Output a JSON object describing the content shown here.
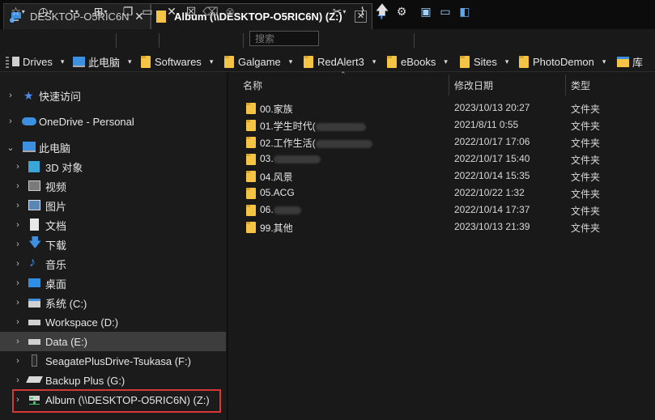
{
  "tabs": [
    {
      "title": "DESKTOP-O5RIC6N",
      "active": false
    },
    {
      "title": "Album (\\\\DESKTOP-O5RIC6N) (Z:)",
      "active": true
    }
  ],
  "tab_close_glyph": "✕",
  "tab_add_glyph": "+",
  "toolbar": {
    "search_placeholder": "搜索"
  },
  "bookmarks": [
    {
      "label": "Drives",
      "icon": "drive-icon"
    },
    {
      "label": "此电脑",
      "icon": "computer-icon"
    },
    {
      "label": "Softwares",
      "icon": "folder-icon"
    },
    {
      "label": "Galgame",
      "icon": "folder-icon"
    },
    {
      "label": "RedAlert3",
      "icon": "folder-icon"
    },
    {
      "label": "eBooks",
      "icon": "folder-icon"
    },
    {
      "label": "Sites",
      "icon": "folder-icon"
    },
    {
      "label": "PhotoDemon",
      "icon": "folder-icon"
    },
    {
      "label": "库",
      "icon": "library-icon"
    }
  ],
  "nav": [
    {
      "label": "快速访问",
      "icon": "star-icon",
      "expanded": false
    },
    {
      "label": "OneDrive - Personal",
      "icon": "cloud-icon",
      "expanded": false
    },
    {
      "label": "此电脑",
      "icon": "computer-icon",
      "expanded": true
    },
    {
      "label": "3D 对象",
      "icon": "cube-icon"
    },
    {
      "label": "视频",
      "icon": "video-icon"
    },
    {
      "label": "图片",
      "icon": "picture-icon"
    },
    {
      "label": "文档",
      "icon": "document-icon"
    },
    {
      "label": "下载",
      "icon": "download-icon"
    },
    {
      "label": "音乐",
      "icon": "music-icon"
    },
    {
      "label": "桌面",
      "icon": "desktop-icon"
    },
    {
      "label": "系统 (C:)",
      "icon": "system-drive-icon"
    },
    {
      "label": "Workspace (D:)",
      "icon": "drive-icon"
    },
    {
      "label": "Data (E:)",
      "icon": "drive-icon",
      "selected": true
    },
    {
      "label": "SeagatePlusDrive-Tsukasa (F:)",
      "icon": "external-drive-icon"
    },
    {
      "label": "Backup Plus (G:)",
      "icon": "external-drive-icon"
    },
    {
      "label": "Album (\\\\DESKTOP-O5RIC6N) (Z:)",
      "icon": "network-drive-icon",
      "highlighted": true
    }
  ],
  "columns": {
    "name": "名称",
    "modified": "修改日期",
    "type": "类型"
  },
  "files": [
    {
      "name": "00.家族",
      "date": "2023/10/13 20:27",
      "type": "文件夹"
    },
    {
      "name": "01.学生时代(",
      "date": "2021/8/11 0:55",
      "type": "文件夹",
      "redacted": true
    },
    {
      "name": "02.工作生活(",
      "date": "2022/10/17 17:06",
      "type": "文件夹",
      "redacted": true
    },
    {
      "name": "03.",
      "date": "2022/10/17 15:40",
      "type": "文件夹",
      "redacted": true
    },
    {
      "name": "04.风景",
      "date": "2022/10/14 15:35",
      "type": "文件夹"
    },
    {
      "name": "05.ACG",
      "date": "2022/10/22 1:32",
      "type": "文件夹"
    },
    {
      "name": "06.",
      "date": "2022/10/14 17:37",
      "type": "文件夹",
      "redacted": true
    },
    {
      "name": "99.其他",
      "date": "2023/10/13 21:39",
      "type": "文件夹"
    }
  ],
  "colors": {
    "accent": "#4b8ef0",
    "folder": "#f6c444",
    "highlight_border": "#d93636",
    "selected_row": "#3d3d3d"
  }
}
